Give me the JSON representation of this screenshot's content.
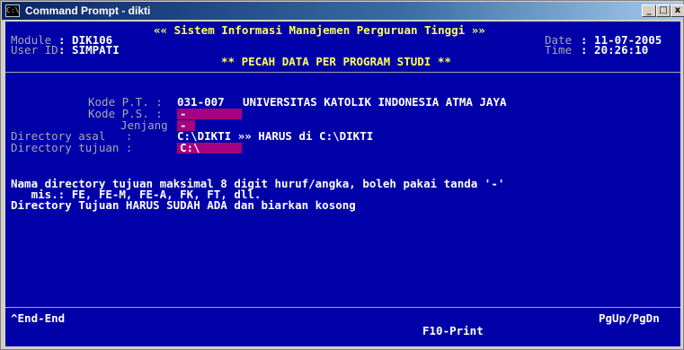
{
  "window": {
    "title": "Command Prompt - dikti",
    "icon_label": "C:\\",
    "minimize": "_",
    "maximize": "□",
    "close": "x"
  },
  "header": {
    "system_title": "«« Sistem Informasi Manajemen Perguruan Tinggi »»",
    "module_label": "Module",
    "module_value": ": DIK106",
    "user_label": "User ID",
    "user_value": ": SIMPATI",
    "date_label": "Date",
    "date_value": ": 11-07-2005",
    "time_label": "Time",
    "time_value": ": 20:26:10",
    "screen_title": "** PECAH DATA PER PROGRAM STUDI **"
  },
  "form": {
    "kode_pt_label": "Kode P.T. :",
    "kode_pt_value": "031-007",
    "institution": "UNIVERSITAS KATOLIK INDONESIA ATMA JAYA",
    "kode_ps_label": "Kode P.S. :",
    "kode_ps_value": "-",
    "jenjang_label": "Jenjang :",
    "jenjang_value": "-",
    "dir_asal_label": "Directory asal   :",
    "dir_asal_value": "C:\\DIKTI »» HARUS di C:\\DIKTI",
    "dir_tujuan_label": "Directory tujuan :",
    "dir_tujuan_value": "C:\\"
  },
  "notes": {
    "line1": "Nama directory tujuan maksimal 8 digit huruf/angka, boleh pakai tanda '-'",
    "line2": "   mis.: FE, FE-M, FE-A, FK, FT, dll.",
    "line3": "Directory Tujuan HARUS SUDAH ADA dan biarkan kosong"
  },
  "footer": {
    "end_hint": "^End-End",
    "page_hint": "PgUp/PgDn",
    "print_hint": "F10-Print"
  }
}
